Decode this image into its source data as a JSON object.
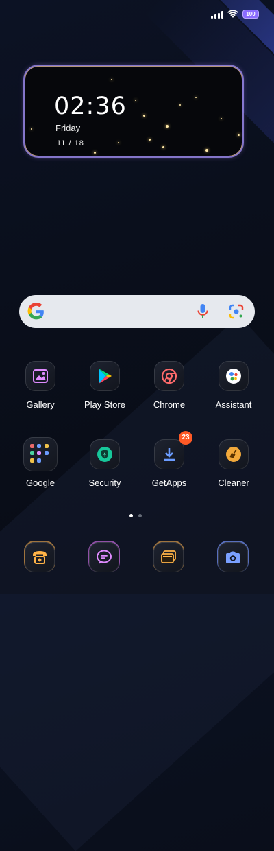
{
  "status_bar": {
    "battery_level": "100",
    "signal_icon": "signal-icon",
    "wifi_icon": "wifi-icon"
  },
  "clock_widget": {
    "time": "02:36",
    "day": "Friday",
    "date": "11 / 18"
  },
  "search_bar": {
    "logo_icon": "google-g-icon",
    "mic_icon": "microphone-icon",
    "lens_icon": "google-lens-icon"
  },
  "apps": [
    {
      "label": "Gallery",
      "icon": "gallery-icon",
      "accent": "#d774ff"
    },
    {
      "label": "Play Store",
      "icon": "play-store-icon",
      "accent": "#7aa0ff"
    },
    {
      "label": "Chrome",
      "icon": "chrome-icon",
      "accent": "#ff6b6b"
    },
    {
      "label": "Assistant",
      "icon": "assistant-icon",
      "accent": "#8aa4ff"
    },
    {
      "label": "Google",
      "icon": "google-folder-icon",
      "accent": "#7e8cff"
    },
    {
      "label": "Security",
      "icon": "security-shield-icon",
      "accent": "#40e0c0"
    },
    {
      "label": "GetApps",
      "icon": "getapps-download-icon",
      "accent": "#6b9cff",
      "badge": "23"
    },
    {
      "label": "Cleaner",
      "icon": "cleaner-broom-icon",
      "accent": "#ffb347"
    }
  ],
  "page_indicator": {
    "pages": 2,
    "current": 1
  },
  "dock": [
    {
      "icon": "phone-icon",
      "accent": "#ffb347"
    },
    {
      "icon": "messages-icon",
      "accent": "#d774ff"
    },
    {
      "icon": "browser-icon",
      "accent": "#ffb347"
    },
    {
      "icon": "camera-icon",
      "accent": "#7aa0ff"
    }
  ]
}
